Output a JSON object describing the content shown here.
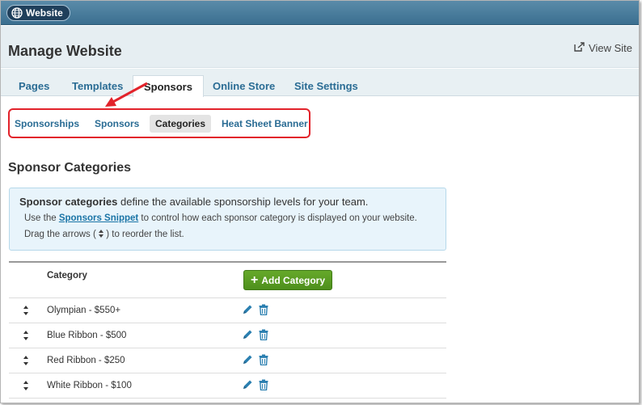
{
  "topbar": {
    "website_label": "Website"
  },
  "header": {
    "title": "Manage Website",
    "view_site_label": "View Site"
  },
  "tabs": [
    {
      "label": "Pages"
    },
    {
      "label": "Templates"
    },
    {
      "label": "Sponsors",
      "active": true
    },
    {
      "label": "Online Store"
    },
    {
      "label": "Site Settings"
    }
  ],
  "subtabs": [
    {
      "label": "Sponsorships"
    },
    {
      "label": "Sponsors"
    },
    {
      "label": "Categories",
      "active": true
    },
    {
      "label": "Heat Sheet Banner"
    }
  ],
  "section": {
    "title": "Sponsor Categories"
  },
  "info": {
    "line1_bold": "Sponsor categories",
    "line1_rest": " define the available sponsorship levels for your team.",
    "line2_prefix": "Use the ",
    "line2_link": "Sponsors Snippet",
    "line2_suffix": " to control how each sponsor category is displayed on your website.",
    "line3_prefix": "Drag the arrows ( ",
    "line3_suffix": " ) to reorder the list."
  },
  "table": {
    "header_category": "Category",
    "add_button_label": "Add Category",
    "rows": [
      {
        "label": "Olympian - $550+"
      },
      {
        "label": "Blue Ribbon - $500"
      },
      {
        "label": "Red Ribbon - $250"
      },
      {
        "label": "White Ribbon - $100"
      }
    ]
  },
  "colors": {
    "accent_link": "#2a6c94",
    "highlight_red": "#e2232b",
    "button_green": "#5a9e24"
  },
  "icons": {
    "website": "globe-icon",
    "view_site": "external-link-icon",
    "drag": "sort-arrows-icon",
    "edit": "pencil-icon",
    "delete": "trash-icon",
    "add": "plus-icon"
  }
}
